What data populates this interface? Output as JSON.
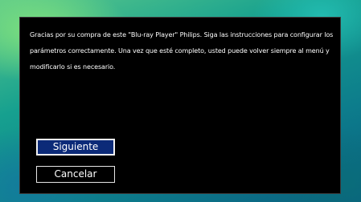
{
  "dialog": {
    "message": "Gracias por su compra de este \"Blu-ray Player\" Philips. Siga las instrucciones para configurar los parámetros correctamente. Una vez que esté completo, usted puede volver siempre al menú y modificarlo si es necesario.",
    "buttons": {
      "next_label": "Siguiente",
      "cancel_label": "Cancelar"
    },
    "focused_button": "Siguiente"
  },
  "colors": {
    "dialog_background": "#000000",
    "focus_highlight": "#0c2a78",
    "text": "#ffffff"
  }
}
